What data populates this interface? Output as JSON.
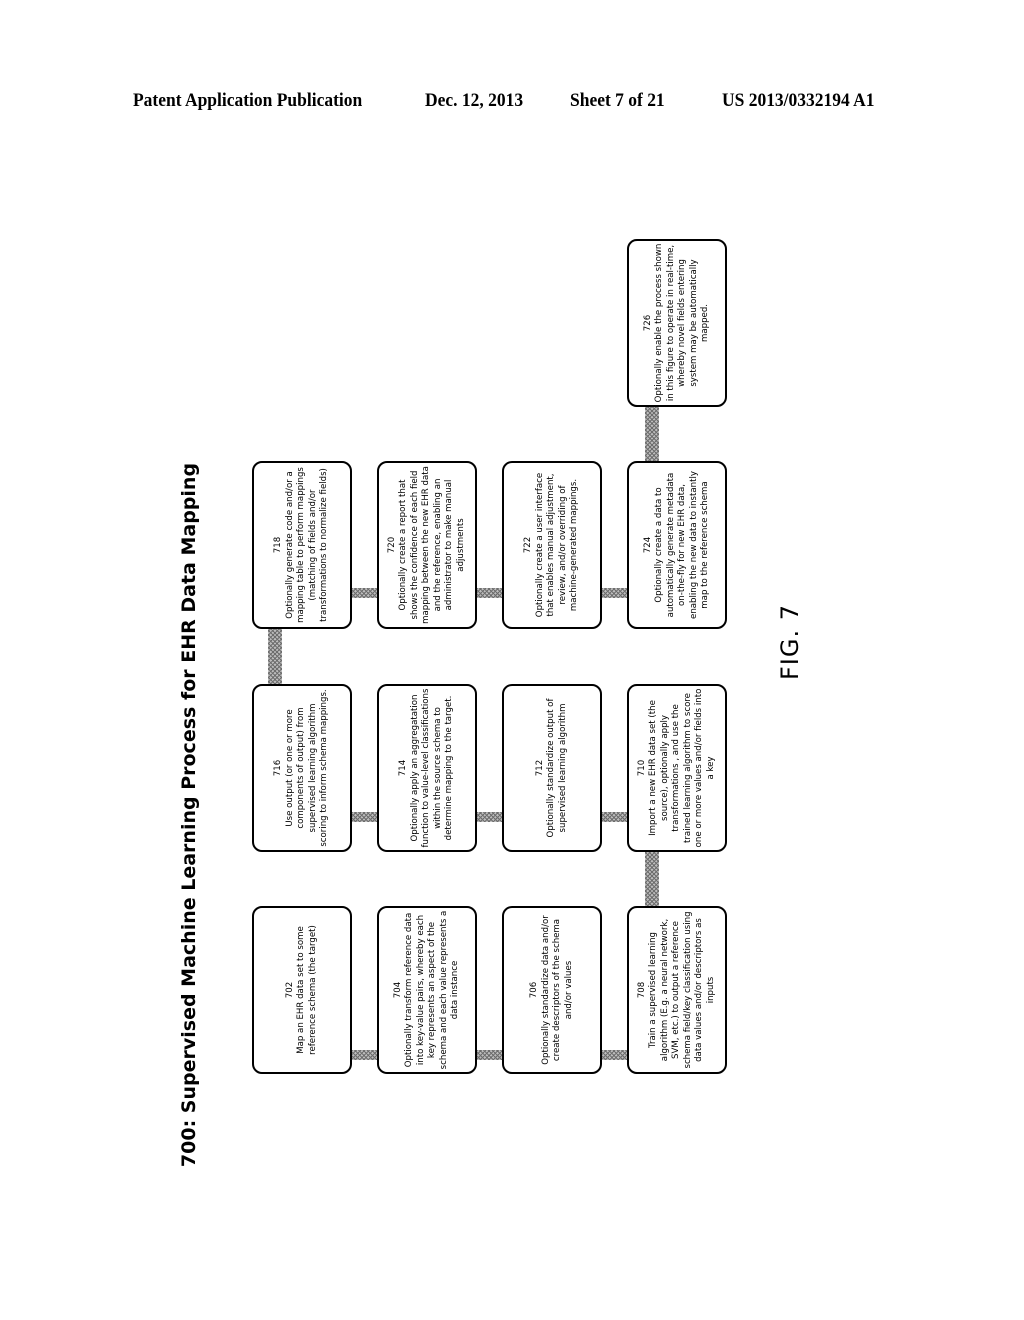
{
  "header": {
    "publication": "Patent Application Publication",
    "date": "Dec. 12, 2013",
    "sheet": "Sheet 7 of 21",
    "number": "US 2013/0332194 A1"
  },
  "diagram": {
    "title": "700: Supervised Machine Learning Process for EHR Data Mapping",
    "figure_label": "FIG. 7",
    "steps": [
      {
        "id": "702",
        "text": "Map an EHR data set to some reference schema (the target)"
      },
      {
        "id": "704",
        "text": "Optionally transform reference data into key-value pairs, whereby each key represents an aspect of the schema and each value represents a data instance"
      },
      {
        "id": "706",
        "text": "Optionally standardize data and/or create descriptors of the schema and/or values"
      },
      {
        "id": "708",
        "text": "Train a supervised learning algorithm (E.g. a neural network, SVM, etc.) to output a reference schema field/key classification using data values and/or descriptors as inputs"
      },
      {
        "id": "710",
        "text": "Import a new EHR data set (the source), optionally apply transformations , and use the trained learning algorithm to score one or more values and/or fields into a key"
      },
      {
        "id": "712",
        "text": "Optionally standardize output of supervised learning algorithm"
      },
      {
        "id": "714",
        "text": "Optionally apply an aggregatation function to value-level classifications within the source schema to determine mapping to the target."
      },
      {
        "id": "716",
        "text": "Use output (or one or more components of output) from supervised learning algorithm scoring to inform schema mappings."
      },
      {
        "id": "718",
        "text": "Optionally generate code and/or a mapping table to perform mappings (matching of fields and/or transformations to normalize fields)"
      },
      {
        "id": "720",
        "text": "Optionally create a report that shows the confidence of each field mapping between the new EHR data and the reference, enabling an administrator to make manual adjustments"
      },
      {
        "id": "722",
        "text": "Optionally create a user interface that enables manual adjustment, review, and/or overriding of machine-generated mappings."
      },
      {
        "id": "724",
        "text": "Optionally create a data to automatically generate metadata on-the-fly for new EHR data, enabling the new data to instantly map to the reference schema"
      },
      {
        "id": "726",
        "text": "Optionally enable the process shown in this figure to operate in real-time, whereby novel fields entering system may be automatically mapped."
      }
    ],
    "connections": [
      [
        "702",
        "704"
      ],
      [
        "704",
        "706"
      ],
      [
        "706",
        "708"
      ],
      [
        "708",
        "710"
      ],
      [
        "710",
        "712"
      ],
      [
        "712",
        "714"
      ],
      [
        "714",
        "716"
      ],
      [
        "716",
        "718"
      ],
      [
        "718",
        "720"
      ],
      [
        "720",
        "722"
      ],
      [
        "722",
        "724"
      ],
      [
        "724",
        "726"
      ]
    ]
  }
}
